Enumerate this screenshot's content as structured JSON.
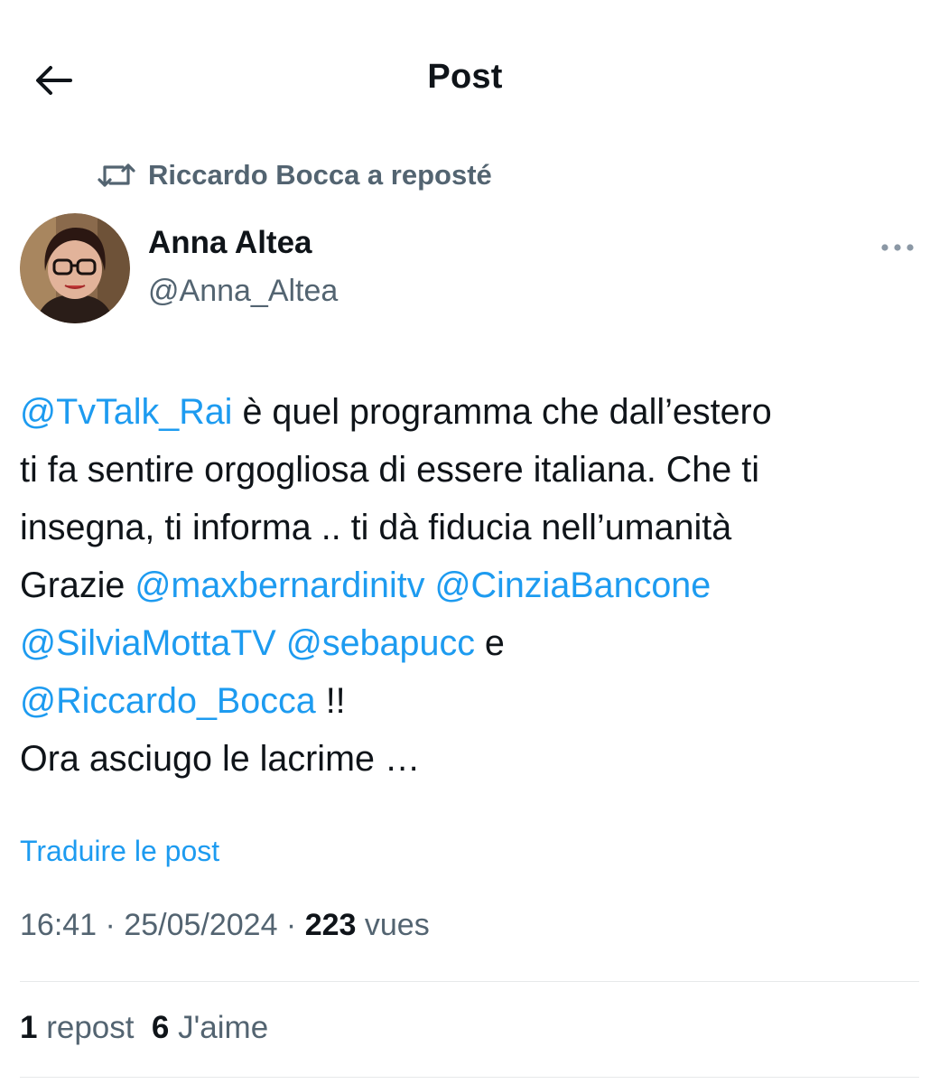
{
  "header": {
    "title": "Post",
    "back_icon": "arrow-left-icon"
  },
  "repost": {
    "icon": "repost-icon",
    "text": "Riccardo Bocca a reposté"
  },
  "author": {
    "name": "Anna Altea",
    "handle": "@Anna_Altea",
    "avatar": "avatar-photo"
  },
  "more_icon": "more-horizontal-icon",
  "tweet": {
    "lines": [
      [
        {
          "text": "@TvTalk_Rai",
          "mention": true
        },
        {
          "text": " è quel programma che dall’estero",
          "mention": false
        }
      ],
      [
        {
          "text": "ti fa sentire orgogliosa di essere italiana. Che ti",
          "mention": false
        }
      ],
      [
        {
          "text": "insegna, ti informa .. ti dà fiducia nell’umanità",
          "mention": false
        }
      ],
      [
        {
          "text": "Grazie ",
          "mention": false
        },
        {
          "text": "@maxbernardinitv",
          "mention": true
        },
        {
          "text": " ",
          "mention": false
        },
        {
          "text": "@CinziaBancone",
          "mention": true
        }
      ],
      [
        {
          "text": "@SilviaMottaTV",
          "mention": true
        },
        {
          "text": " ",
          "mention": false
        },
        {
          "text": "@sebapucc",
          "mention": true
        },
        {
          "text": " e",
          "mention": false
        }
      ],
      [
        {
          "text": "@Riccardo_Bocca",
          "mention": true
        },
        {
          "text": " !!",
          "mention": false
        }
      ],
      [
        {
          "text": "Ora asciugo le lacrime …",
          "mention": false
        }
      ]
    ]
  },
  "translate_label": "Traduire le post",
  "meta": {
    "time": "16:41",
    "separator": " · ",
    "date": "25/05/2024",
    "views_count": "223",
    "views_label": " vues"
  },
  "stats": {
    "reposts_count": "1",
    "reposts_label": " repost",
    "likes_count": "6",
    "likes_label": " J'aime"
  },
  "colors": {
    "link": "#1d9bf0",
    "secondary_text": "#536471",
    "primary_text": "#0f1419",
    "divider": "#e7e9ea"
  }
}
